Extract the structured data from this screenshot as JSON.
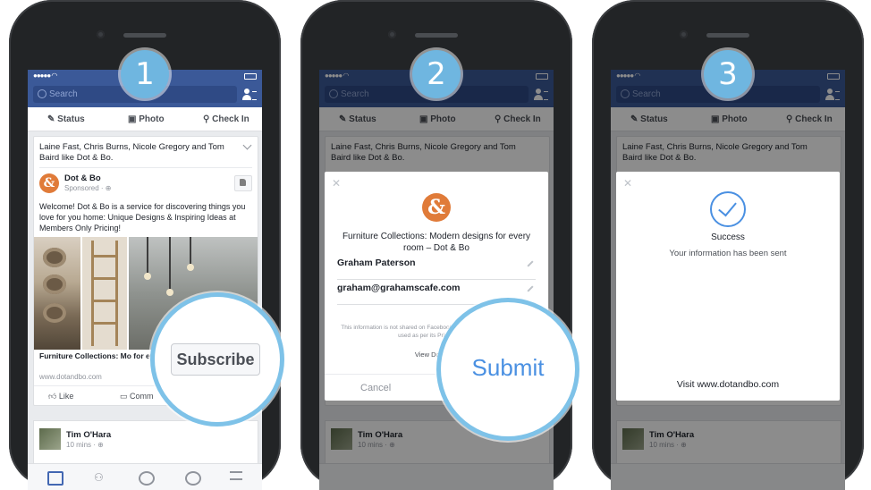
{
  "steps": [
    "1",
    "2",
    "3"
  ],
  "search": {
    "placeholder": "Search"
  },
  "composer": {
    "status": "Status",
    "photo": "Photo",
    "checkin": "Check In"
  },
  "post": {
    "likers": "Laine Fast, Chris Burns, Nicole Gregory and Tom Baird like Dot & Bo.",
    "page_name": "Dot & Bo",
    "sponsored": "Sponsored · ⊕",
    "text": "Welcome! Dot & Bo is a service for discovering things you love for you home: Unique Designs & Inspiring Ideas at Members Only Pricing!",
    "caption": "Furniture Collections: Mo for every room – Dot & Bo",
    "url": "www.dotandbo.com",
    "like": "Like",
    "comment": "Comm",
    "cta": "Subscribe"
  },
  "second_post": {
    "name": "Tim O'Hara",
    "time": "10 mins · ⊕"
  },
  "lead_form": {
    "title": "Furniture Collections: Modern designs for every room – Dot & Bo",
    "name_value": "Graham Paterson",
    "email_value": "graham@grahamscafe.com",
    "disclaimer": "This information is not shared on Facebook. It will be sent to Dot & Bo and used as per its Privacy Policy.",
    "view_link": "View Dot & Bo",
    "cancel": "Cancel",
    "submit": "Submit"
  },
  "success": {
    "title": "Success",
    "subtitle": "Your information has been sent",
    "visit": "Visit www.dotandbo.com"
  },
  "colors": {
    "facebook_blue": "#3b5998",
    "accent_blue": "#4a90e2",
    "ring_blue": "#7ec2e8",
    "brand_orange": "#e07b39"
  }
}
